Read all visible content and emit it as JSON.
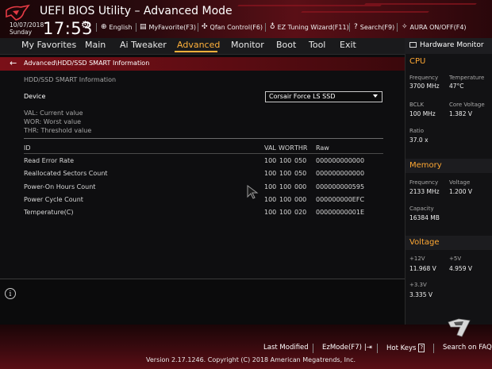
{
  "header": {
    "title": "UEFI BIOS Utility – Advanced Mode",
    "date": "10/07/2018",
    "day": "Sunday",
    "time": "17:53",
    "tools": [
      {
        "icon": "globe-icon",
        "label": "English"
      },
      {
        "icon": "star-icon",
        "label": "MyFavorite(F3)"
      },
      {
        "icon": "fan-icon",
        "label": "Qfan Control(F6)"
      },
      {
        "icon": "bulb-icon",
        "label": "EZ Tuning Wizard(F11)"
      },
      {
        "icon": "question-icon",
        "label": "Search(F9)"
      },
      {
        "icon": "aura-icon",
        "label": "AURA ON/OFF(F4)"
      }
    ]
  },
  "nav": {
    "tabs": [
      "My Favorites",
      "Main",
      "Ai Tweaker",
      "Advanced",
      "Monitor",
      "Boot",
      "Tool",
      "Exit"
    ],
    "active": "Advanced"
  },
  "breadcrumb": "Advanced\\HDD/SSD SMART Information",
  "main": {
    "section_title": "HDD/SSD SMART Information",
    "device_label": "Device",
    "device_value": "Corsair Force LS SSD",
    "legend": [
      "VAL:  Current value",
      "WOR: Worst value",
      "THR:  Threshold value"
    ],
    "columns": {
      "id": "ID",
      "val": "VAL",
      "wor": "WOR",
      "thr": "THR",
      "raw": "Raw"
    },
    "rows": [
      {
        "id": "Read Error Rate",
        "val": "100",
        "wor": "100",
        "thr": "050",
        "raw": "000000000000"
      },
      {
        "id": "Reallocated Sectors Count",
        "val": "100",
        "wor": "100",
        "thr": "050",
        "raw": "000000000000"
      },
      {
        "id": "Power-On Hours Count",
        "val": "100",
        "wor": "100",
        "thr": "000",
        "raw": "000000000595"
      },
      {
        "id": "Power Cycle Count",
        "val": "100",
        "wor": "100",
        "thr": "000",
        "raw": "000000000EFC"
      },
      {
        "id": "Temperature(C)",
        "val": "100",
        "wor": "100",
        "thr": "020",
        "raw": "00000000001E"
      }
    ]
  },
  "hardware_monitor": {
    "title": "Hardware Monitor",
    "cpu": {
      "title": "CPU",
      "frequency_label": "Frequency",
      "frequency": "3700 MHz",
      "temperature_label": "Temperature",
      "temperature": "47°C",
      "bclk_label": "BCLK",
      "bclk": "100 MHz",
      "core_voltage_label": "Core Voltage",
      "core_voltage": "1.382 V",
      "ratio_label": "Ratio",
      "ratio": "37.0 x"
    },
    "memory": {
      "title": "Memory",
      "frequency_label": "Frequency",
      "frequency": "2133 MHz",
      "voltage_label": "Voltage",
      "voltage": "1.200 V",
      "capacity_label": "Capacity",
      "capacity": "16384 MB"
    },
    "voltage": {
      "title": "Voltage",
      "v12_label": "+12V",
      "v12": "11.968 V",
      "v5_label": "+5V",
      "v5": "4.959 V",
      "v33_label": "+3.3V",
      "v33": "3.335 V"
    }
  },
  "footer": {
    "last_modified": "Last Modified",
    "ezmode": "EzMode(F7)",
    "hotkeys": "Hot Keys",
    "hotkeys_key": "?",
    "search_faq": "Search on FAQ",
    "version": "Version 2.17.1246. Copyright (C) 2018 American Megatrends, Inc."
  },
  "colors": {
    "accent": "#ffb13b",
    "brand_red": "#7a1018",
    "section_orange": "#ffa833"
  }
}
